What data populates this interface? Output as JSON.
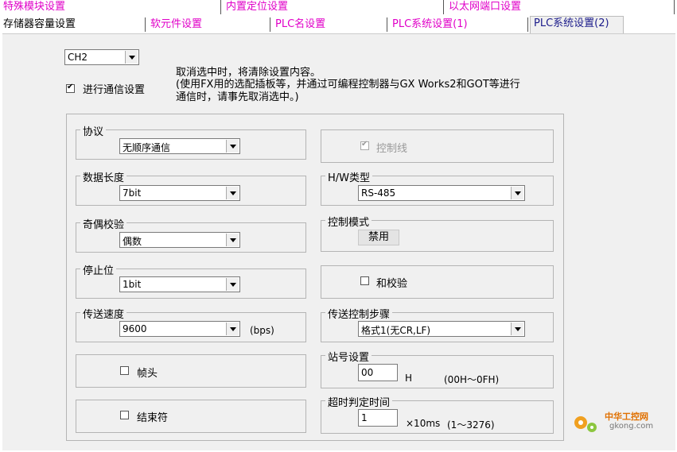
{
  "tabs_row1": [
    {
      "label": "特殊模块设置"
    },
    {
      "label": "内置定位设置"
    },
    {
      "label": "以太网端口设置"
    }
  ],
  "tabs_row2": [
    {
      "label": "存储器容量设置"
    },
    {
      "label": "软元件设置"
    },
    {
      "label": "PLC名设置"
    },
    {
      "label": "PLC系统设置(1)"
    },
    {
      "label": "PLC系统设置(2)"
    }
  ],
  "channel": {
    "value": "CH2"
  },
  "comm_setting": {
    "label": "进行通信设置",
    "checked": true
  },
  "notice": {
    "line1": "取消选中时，将清除设置内容。",
    "line2": "(使用FX用的选配插板等，并通过可编程控制器与GX Works2和GOT等进行",
    "line3": "通信时，请事先取消选中。)"
  },
  "protocol": {
    "legend": "协议",
    "value": "无顺序通信"
  },
  "data_length": {
    "legend": "数据长度",
    "value": "7bit"
  },
  "parity": {
    "legend": "奇偶校验",
    "value": "偶数"
  },
  "stop_bit": {
    "legend": "停止位",
    "value": "1bit"
  },
  "baud_rate": {
    "legend": "传送速度",
    "value": "9600",
    "unit": "(bps)"
  },
  "header": {
    "label": "帧头",
    "checked": false
  },
  "terminator": {
    "label": "结束符",
    "checked": false
  },
  "control_line": {
    "label": "控制线",
    "checked": true,
    "disabled": true
  },
  "hw_type": {
    "legend": "H/W类型",
    "value": "RS-485"
  },
  "control_mode": {
    "legend": "控制模式",
    "value": "禁用"
  },
  "sum_check": {
    "label": "和校验",
    "checked": false
  },
  "transfer_control": {
    "legend": "传送控制步骤",
    "value": "格式1(无CR,LF)"
  },
  "station_no": {
    "legend": "站号设置",
    "value": "00",
    "unit": "H",
    "range": "(00H～0FH)"
  },
  "timeout": {
    "legend": "超时判定时间",
    "value": "1",
    "unit": "×10ms",
    "range": "(1～3276)"
  },
  "watermark": {
    "text1": "中华工控网",
    "text2": "gkong.com"
  },
  "colors": {
    "tab_magenta": "#e000c8",
    "active_tab": "#1a1a8a",
    "panel_bg": "#f0f0f0"
  }
}
